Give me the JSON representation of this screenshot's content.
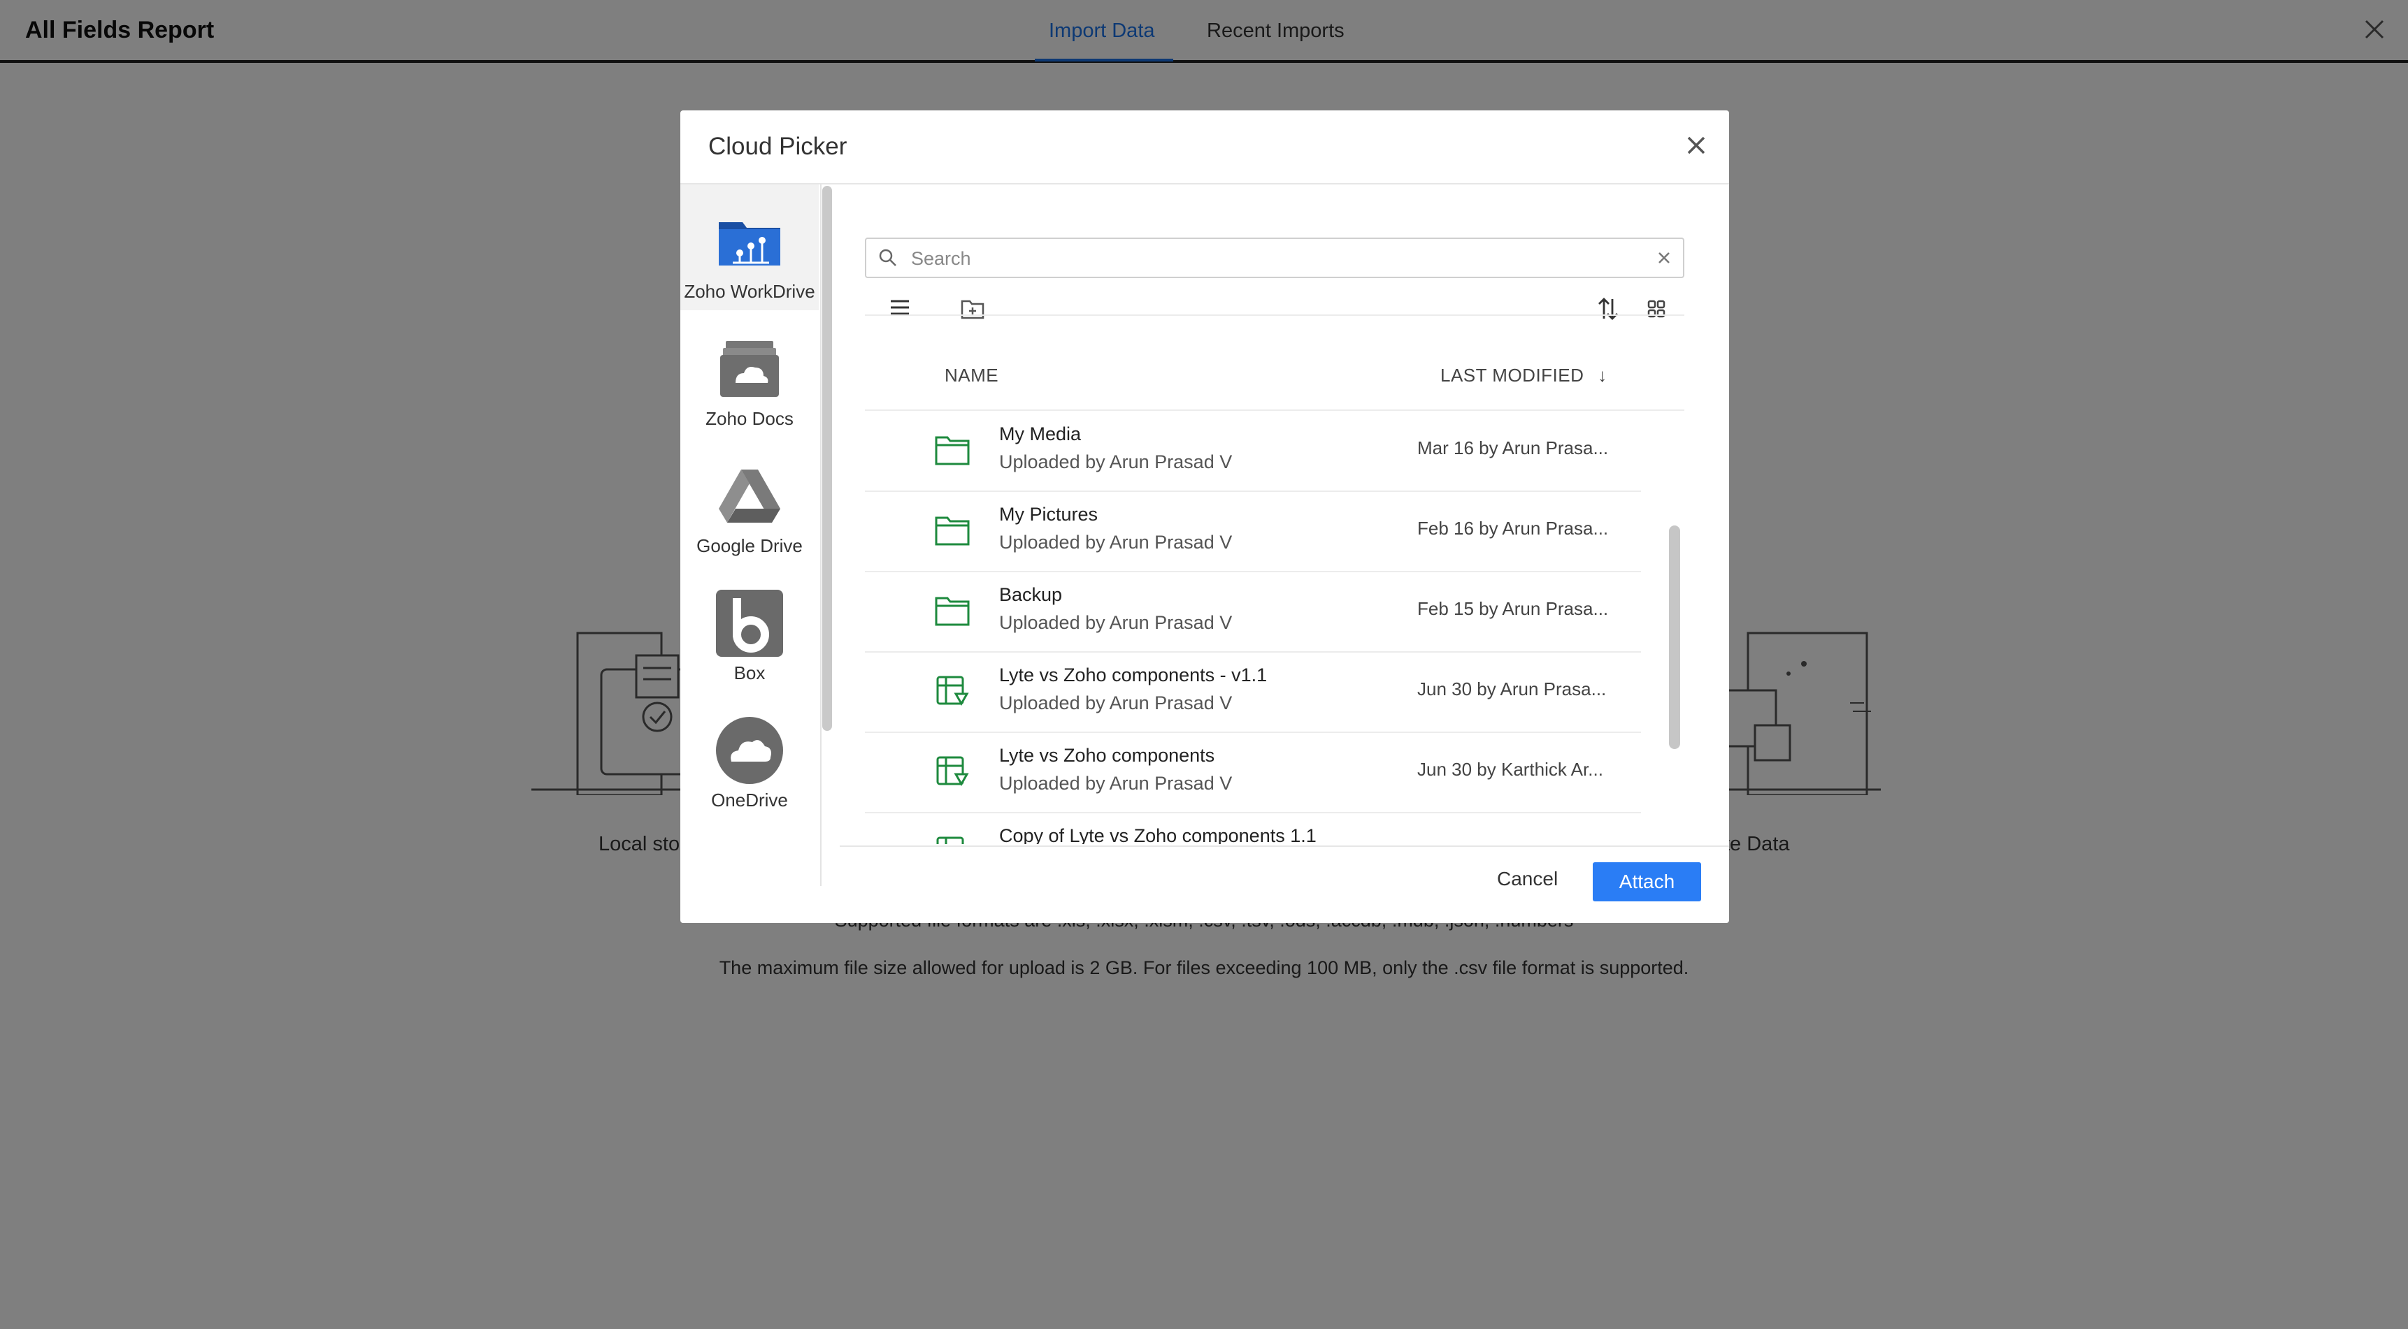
{
  "page": {
    "title": "All Fields Report",
    "tabs": [
      {
        "label": "Import Data",
        "active": true
      },
      {
        "label": "Recent Imports",
        "active": false
      }
    ],
    "options": [
      {
        "label": "Local sto"
      },
      {
        "label": "te Data"
      }
    ],
    "formats_text": "Supported file formats are .xls, .xlsx, .xlsm, .csv, .tsv, .ods, .accdb, .mdb, .json, .numbers",
    "size_text": "The maximum file size allowed for upload is 2 GB. For files exceeding 100 MB, only the .csv file format is supported."
  },
  "dialog": {
    "title": "Cloud Picker",
    "services": [
      {
        "label": "Zoho WorkDrive",
        "icon": "zoho-workdrive-icon",
        "active": true
      },
      {
        "label": "Zoho Docs",
        "icon": "zoho-docs-icon",
        "active": false
      },
      {
        "label": "Google Drive",
        "icon": "google-drive-icon",
        "active": false
      },
      {
        "label": "Box",
        "icon": "box-icon",
        "active": false
      },
      {
        "label": "OneDrive",
        "icon": "onedrive-icon",
        "active": false
      }
    ],
    "search": {
      "placeholder": "Search",
      "value": ""
    },
    "columns": {
      "name": "NAME",
      "modified": "LAST MODIFIED",
      "sort_indicator": "↓"
    },
    "files": [
      {
        "name": "My Media",
        "sub": "Uploaded by Arun Prasad V",
        "modified": "Mar 16 by Arun Prasa...",
        "type": "folder"
      },
      {
        "name": "My Pictures",
        "sub": "Uploaded by Arun Prasad V",
        "modified": "Feb 16 by Arun Prasa...",
        "type": "folder"
      },
      {
        "name": "Backup",
        "sub": "Uploaded by Arun Prasad V",
        "modified": "Feb 15 by Arun Prasa...",
        "type": "folder"
      },
      {
        "name": "Lyte vs Zoho components - v1.1",
        "sub": "Uploaded by Arun Prasad V",
        "modified": "Jun 30 by Arun Prasa...",
        "type": "spreadsheet"
      },
      {
        "name": "Lyte vs Zoho components",
        "sub": "Uploaded by Arun Prasad V",
        "modified": "Jun 30 by Karthick Ar...",
        "type": "spreadsheet"
      },
      {
        "name": "Copy of Lyte vs Zoho components 1.1",
        "sub": "",
        "modified": "",
        "type": "spreadsheet"
      }
    ],
    "cancel_label": "Cancel",
    "attach_label": "Attach"
  },
  "colors": {
    "accent": "#1a73e8",
    "button": "#2a7df5",
    "folder": "#1e8a3e"
  }
}
